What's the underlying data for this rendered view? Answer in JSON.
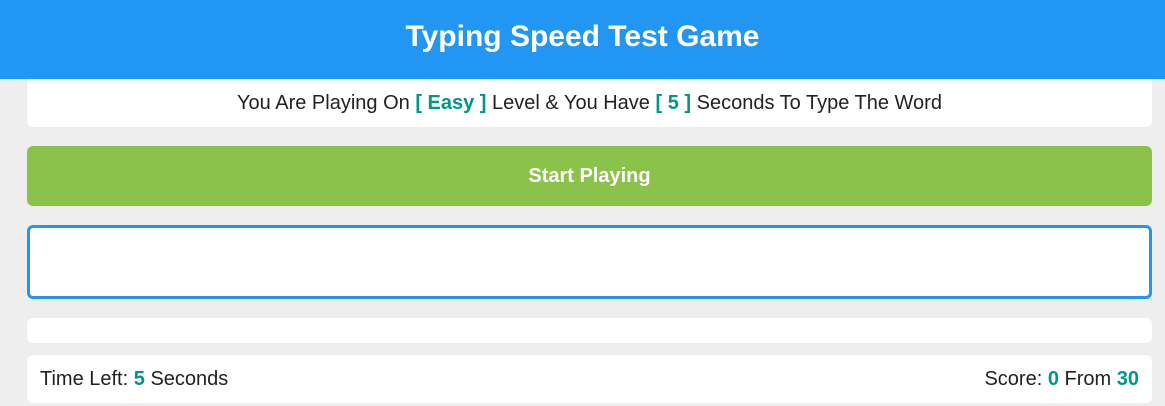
{
  "header": {
    "title": "Typing Speed Test Game"
  },
  "message": {
    "prefix": "You Are Playing On",
    "level": "[ Easy ]",
    "middle": "Level & You Have",
    "seconds": "[ 5 ]",
    "suffix": "Seconds To Type The Word"
  },
  "start_button": {
    "label": "Start Playing"
  },
  "input": {
    "value": "",
    "placeholder": ""
  },
  "upcoming_words": [],
  "control": {
    "time_label": "Time Left:",
    "time_value": "5",
    "time_unit": "Seconds",
    "score_label": "Score:",
    "score_value": "0",
    "score_from_label": "From",
    "score_total": "30"
  },
  "colors": {
    "header": "#2196f3",
    "accent": "#009688",
    "start_button": "#8bc34a",
    "input_border": "#2196f3",
    "background": "#eeeeee"
  }
}
